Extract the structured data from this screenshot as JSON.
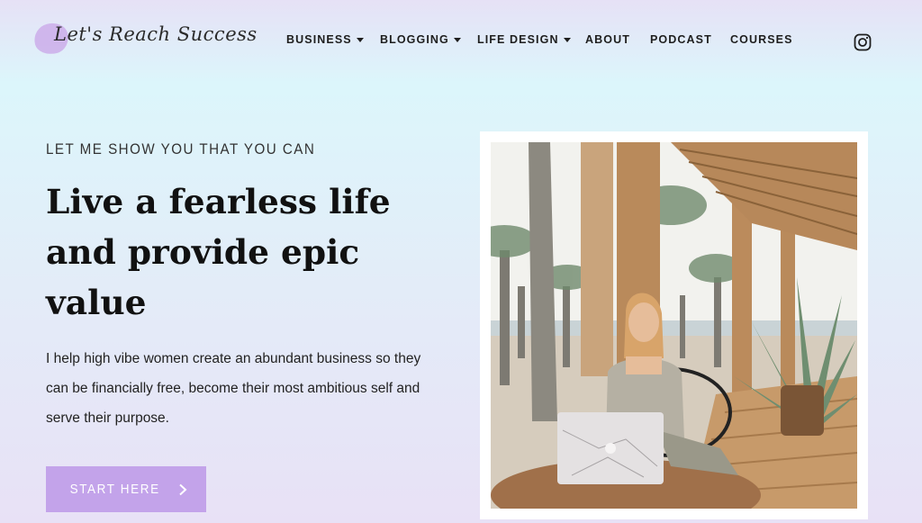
{
  "brand": {
    "logo_text": "Let's Reach Success",
    "accent": "#c3a3ea"
  },
  "nav": {
    "items": [
      {
        "label": "BUSINESS",
        "dropdown": true
      },
      {
        "label": "BLOGGING",
        "dropdown": true
      },
      {
        "label": "LIFE DESIGN",
        "dropdown": true
      },
      {
        "label": "ABOUT",
        "dropdown": false
      },
      {
        "label": "PODCAST",
        "dropdown": false
      },
      {
        "label": "COURSES",
        "dropdown": false
      }
    ],
    "social_icon": "instagram-icon"
  },
  "hero": {
    "eyebrow": "LET ME SHOW YOU THAT YOU CAN",
    "headline": "Live a fearless life and provide epic value",
    "body": "I help high vibe women create an abundant business so they can be financially free, become their most ambitious self and serve their purpose.",
    "cta_label": "START HERE",
    "cta_icon": "chevron-right-icon"
  }
}
